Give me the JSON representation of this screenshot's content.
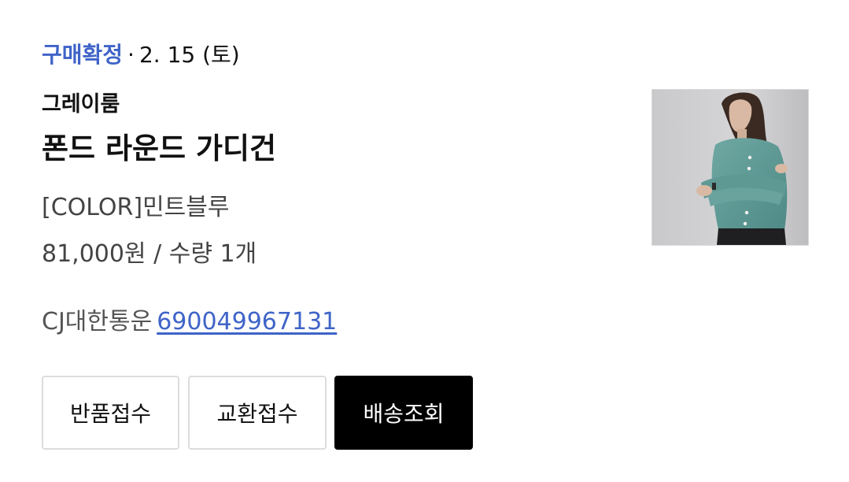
{
  "order": {
    "status_label": "구매확정",
    "separator": "·",
    "date": "2. 15 (토)",
    "brand": "그레이룸",
    "product_name": "폰드 라운드 가디건",
    "option": "[COLOR]민트블루",
    "price_qty": "81,000원 / 수량 1개",
    "courier": "CJ대한통운",
    "tracking_number": "690049967131",
    "thumbnail_icon": "product-photo-mint-cardigan"
  },
  "actions": {
    "return_label": "반품접수",
    "exchange_label": "교환접수",
    "track_label": "배송조회"
  },
  "colors": {
    "accent": "#3f64c8",
    "primary_button": "#000000"
  }
}
